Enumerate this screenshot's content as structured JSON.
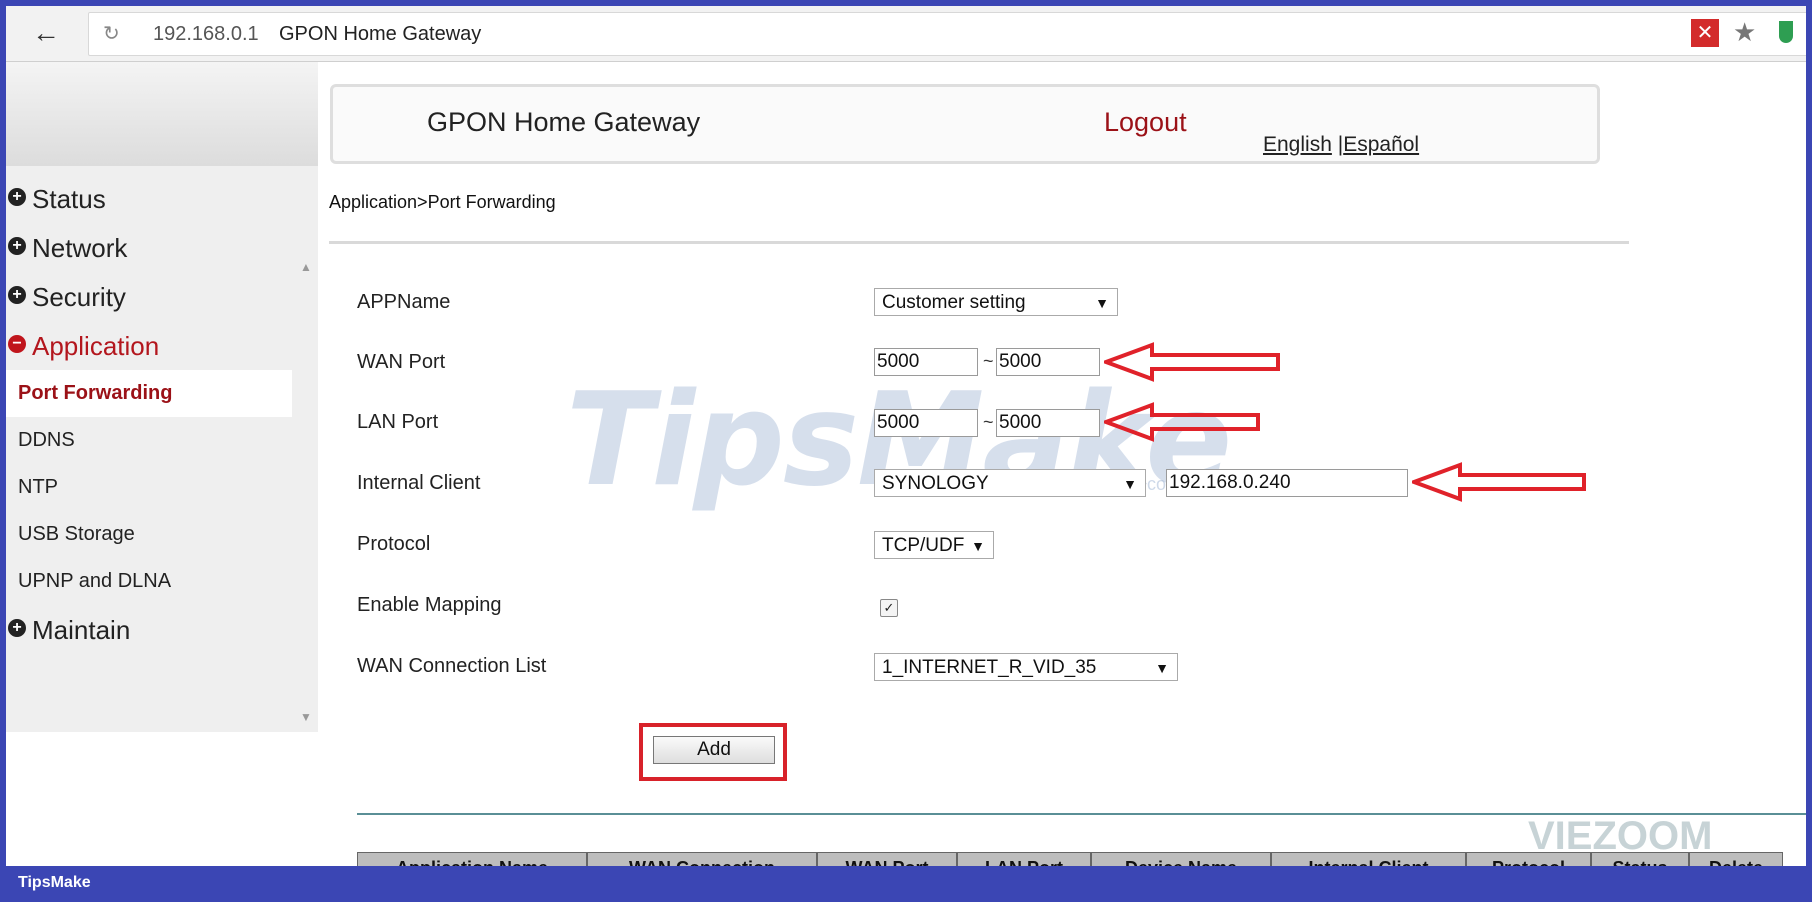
{
  "browser": {
    "url_host": "192.168.0.1",
    "tab_title": "GPON Home Gateway"
  },
  "header": {
    "title": "GPON Home Gateway",
    "logout": "Logout",
    "lang_english": "English",
    "lang_separator": "|",
    "lang_spanish": "Español"
  },
  "breadcrumb": "Application>Port Forwarding",
  "sidebar": {
    "menus": [
      {
        "label": "Status",
        "icon": "+"
      },
      {
        "label": "Network",
        "icon": "+"
      },
      {
        "label": "Security",
        "icon": "+"
      },
      {
        "label": "Application",
        "icon": "−"
      }
    ],
    "submenu": [
      "Port Forwarding",
      "DDNS",
      "NTP",
      "USB Storage",
      "UPNP and DLNA"
    ],
    "last_menu": {
      "label": "Maintain",
      "icon": "+"
    }
  },
  "form": {
    "appname_label": "APPName",
    "appname_value": "Customer setting",
    "wan_port_label": "WAN Port",
    "wan_port_start": "5000",
    "wan_port_end": "5000",
    "lan_port_label": "LAN Port",
    "lan_port_start": "5000",
    "lan_port_end": "5000",
    "tilde": "~",
    "internal_client_label": "Internal Client",
    "internal_client_device": "SYNOLOGY",
    "internal_client_ip": "192.168.0.240",
    "protocol_label": "Protocol",
    "protocol_value": "TCP/UDF",
    "enable_mapping_label": "Enable Mapping",
    "enable_mapping_checked": true,
    "wan_connection_label": "WAN Connection List",
    "wan_connection_value": "1_INTERNET_R_VID_35",
    "add_button": "Add"
  },
  "table_headers": [
    "Application Name",
    "WAN Connection",
    "WAN Port",
    "LAN Port",
    "Device Name",
    "Internal Client",
    "Protocol",
    "Status",
    "Delete"
  ],
  "watermark": {
    "main": "TipsMake",
    "sub": ".com",
    "logo": "VIEZOOM"
  },
  "footer_brand": "TipsMake",
  "colors": {
    "accent_red": "#9b1117",
    "arrow_red": "#e0222a",
    "frame_blue": "#3b46b4"
  }
}
